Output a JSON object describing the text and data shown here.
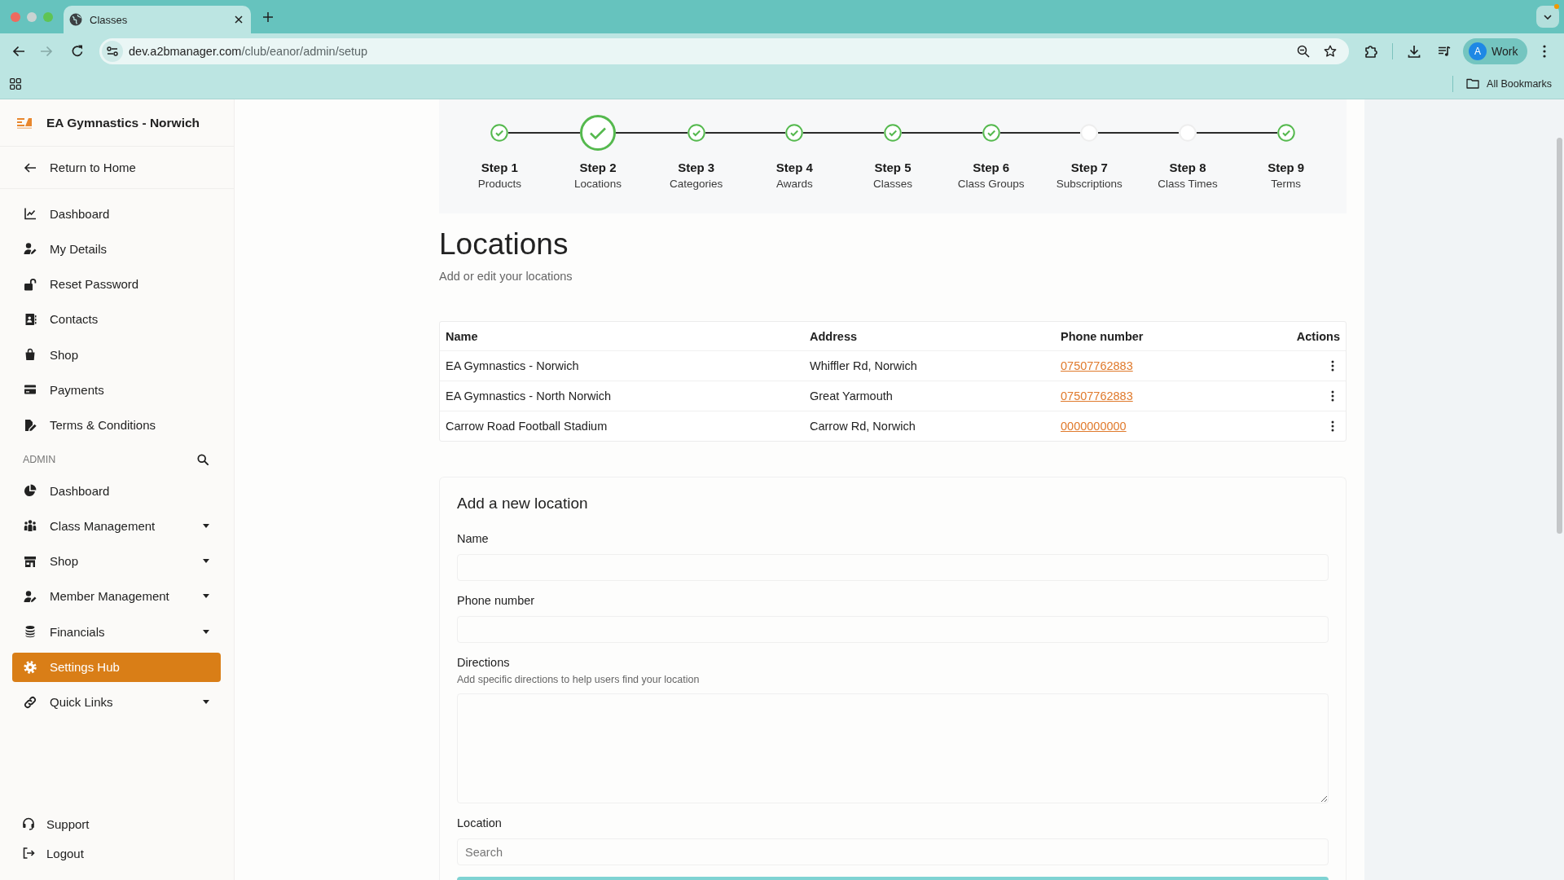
{
  "browser": {
    "tab": {
      "title": "Classes"
    },
    "forward_disabled": true,
    "address": {
      "host": "dev.a2bmanager.com",
      "path": "/club/eanor/admin/setup"
    },
    "profile": {
      "initial": "A",
      "label": "Work"
    },
    "bookmarks_label": "All Bookmarks"
  },
  "sidebar": {
    "club_name": "EA Gymnastics - Norwich",
    "return_link": "Return to Home",
    "items": [
      {
        "label": "Dashboard",
        "selected": false
      },
      {
        "label": "My Details",
        "selected": false
      },
      {
        "label": "Reset Password",
        "selected": false
      },
      {
        "label": "Contacts",
        "selected": false
      },
      {
        "label": "Shop",
        "selected": false
      },
      {
        "label": "Payments",
        "selected": false
      },
      {
        "label": "Terms & Conditions",
        "selected": false
      }
    ],
    "admin_label": "ADMIN",
    "admin_items": [
      {
        "label": "Dashboard",
        "expandable": false,
        "selected": false
      },
      {
        "label": "Class Management",
        "expandable": true,
        "selected": false
      },
      {
        "label": "Shop",
        "expandable": true,
        "selected": false
      },
      {
        "label": "Member Management",
        "expandable": true,
        "selected": false
      },
      {
        "label": "Financials",
        "expandable": true,
        "selected": false
      },
      {
        "label": "Settings Hub",
        "expandable": false,
        "selected": true
      },
      {
        "label": "Quick Links",
        "expandable": true,
        "selected": false
      }
    ],
    "footer_items": [
      {
        "label": "Support"
      },
      {
        "label": "Logout"
      }
    ]
  },
  "stepper": {
    "steps": [
      {
        "title": "Step 1",
        "label": "Products",
        "completed": true,
        "selected": false
      },
      {
        "title": "Step 2",
        "label": "Locations",
        "completed": true,
        "selected": true
      },
      {
        "title": "Step 3",
        "label": "Categories",
        "completed": true,
        "selected": false
      },
      {
        "title": "Step 4",
        "label": "Awards",
        "completed": true,
        "selected": false
      },
      {
        "title": "Step 5",
        "label": "Classes",
        "completed": true,
        "selected": false
      },
      {
        "title": "Step 6",
        "label": "Class Groups",
        "completed": true,
        "selected": false
      },
      {
        "title": "Step 7",
        "label": "Subscriptions",
        "completed": false,
        "selected": false
      },
      {
        "title": "Step 8",
        "label": "Class Times",
        "completed": false,
        "selected": false
      },
      {
        "title": "Step 9",
        "label": "Terms",
        "completed": true,
        "selected": false
      }
    ]
  },
  "page": {
    "title": "Locations",
    "subtitle": "Add or edit your locations"
  },
  "table": {
    "columns": [
      "Name",
      "Address",
      "Phone number",
      "Actions"
    ],
    "rows": [
      {
        "name": "EA Gymnastics - Norwich",
        "address": "Whiffler Rd, Norwich",
        "phone": "07507762883"
      },
      {
        "name": "EA Gymnastics - North Norwich",
        "address": "Great Yarmouth",
        "phone": "07507762883"
      },
      {
        "name": "Carrow Road Football Stadium",
        "address": "Carrow Rd, Norwich",
        "phone": "0000000000"
      }
    ]
  },
  "form": {
    "title": "Add a new location",
    "fields": [
      {
        "kind": "input",
        "label": "Name"
      },
      {
        "kind": "input",
        "label": "Phone number"
      },
      {
        "kind": "textarea",
        "label": "Directions",
        "hint": "Add specific directions to help users find your location"
      },
      {
        "kind": "search",
        "label": "Location",
        "placeholder": "Search"
      }
    ]
  }
}
